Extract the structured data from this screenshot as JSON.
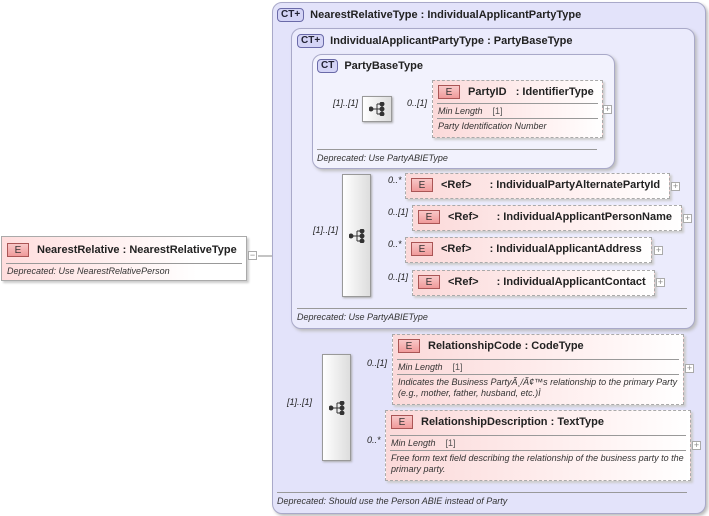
{
  "root": {
    "badge": "E",
    "name": "NearestRelative",
    "type": ": NearestRelativeType",
    "note": "Deprecated: Use NearestRelativePerson",
    "toggle": "−"
  },
  "outer": {
    "badge": "CT+",
    "name": "NearestRelativeType",
    "type": ": IndividualApplicantPartyType",
    "note": "Deprecated: Should use the Person ABIE instead of Party"
  },
  "middle": {
    "badge": "CT+",
    "name": "IndividualApplicantPartyType",
    "type": ": PartyBaseType",
    "note": "Deprecated: Use PartyABIEType"
  },
  "inner": {
    "badge": "CT",
    "name": "PartyBaseType",
    "note": "Deprecated: Use PartyABIEType"
  },
  "seq1": {
    "card": "[1]..[1]"
  },
  "seq2": {
    "card": "[1]..[1]"
  },
  "seq3": {
    "card": "[1]..[1]"
  },
  "partyId": {
    "badge": "E",
    "name": "PartyID",
    "type": ": IdentifierType",
    "card": "0..[1]",
    "facet": "Min Length",
    "facet_val": "[1]",
    "doc": "Party Identification Number",
    "toggle": "+"
  },
  "refs": [
    {
      "badge": "E",
      "ref": "<Ref>",
      "name": ": IndividualPartyAlternatePartyId",
      "card": "0..*",
      "toggle": "+"
    },
    {
      "badge": "E",
      "ref": "<Ref>",
      "name": ": IndividualApplicantPersonName",
      "card": "0..[1]",
      "toggle": "+"
    },
    {
      "badge": "E",
      "ref": "<Ref>",
      "name": ": IndividualApplicantAddress",
      "card": "0..*",
      "toggle": "+"
    },
    {
      "badge": "E",
      "ref": "<Ref>",
      "name": ": IndividualApplicantContact",
      "card": "0..[1]",
      "toggle": "+"
    }
  ],
  "relCode": {
    "badge": "E",
    "name": "RelationshipCode",
    "type": ": CodeType",
    "card": "0..[1]",
    "facet": "Min Length",
    "facet_val": "[1]",
    "doc": "Indicates the Business PartyÃ¸/Ã¢™s relationship to the primary Party (e.g., mother, father, husband, etc.)Ì",
    "toggle": "+"
  },
  "relDesc": {
    "badge": "E",
    "name": "RelationshipDescription",
    "type": ": TextType",
    "card": "0..*",
    "facet": "Min Length",
    "facet_val": "[1]",
    "doc": "Free form text field describing the relationship of the business party to the primary party.",
    "toggle": "+"
  }
}
